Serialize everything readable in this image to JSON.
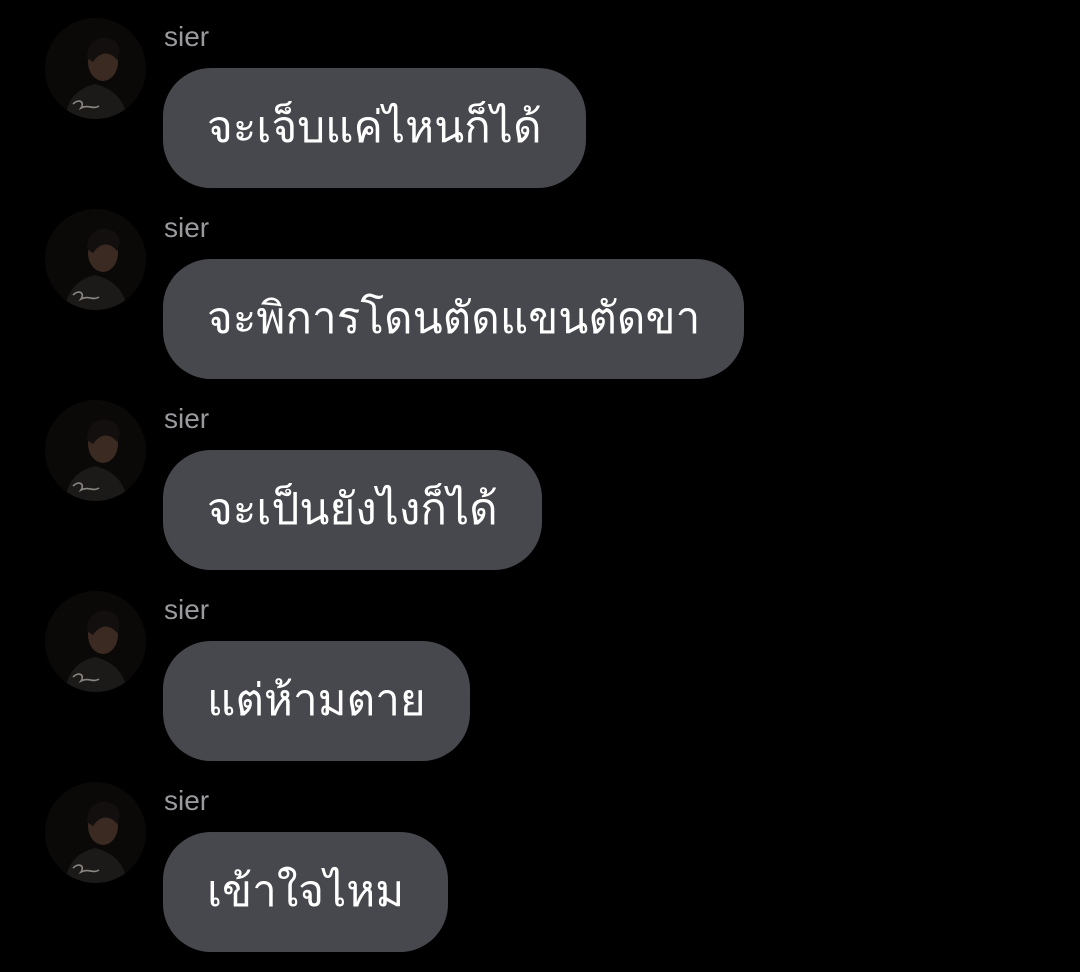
{
  "conversation": {
    "messages": [
      {
        "sender": "sier",
        "text": "จะเจ็บแค่ไหนก็ได้"
      },
      {
        "sender": "sier",
        "text": "จะพิการโดนตัดแขนตัดขา"
      },
      {
        "sender": "sier",
        "text": "จะเป็นยังไงก็ได้"
      },
      {
        "sender": "sier",
        "text": "แต่ห้ามตาย"
      },
      {
        "sender": "sier",
        "text": "เข้าใจไหม"
      }
    ]
  },
  "theme": {
    "background": "#000000",
    "bubble": "#47484e",
    "bubble_text": "#ffffff",
    "sender_text": "#9a9a9e"
  },
  "icons": {
    "avatar": "profile-photo-avatar"
  }
}
